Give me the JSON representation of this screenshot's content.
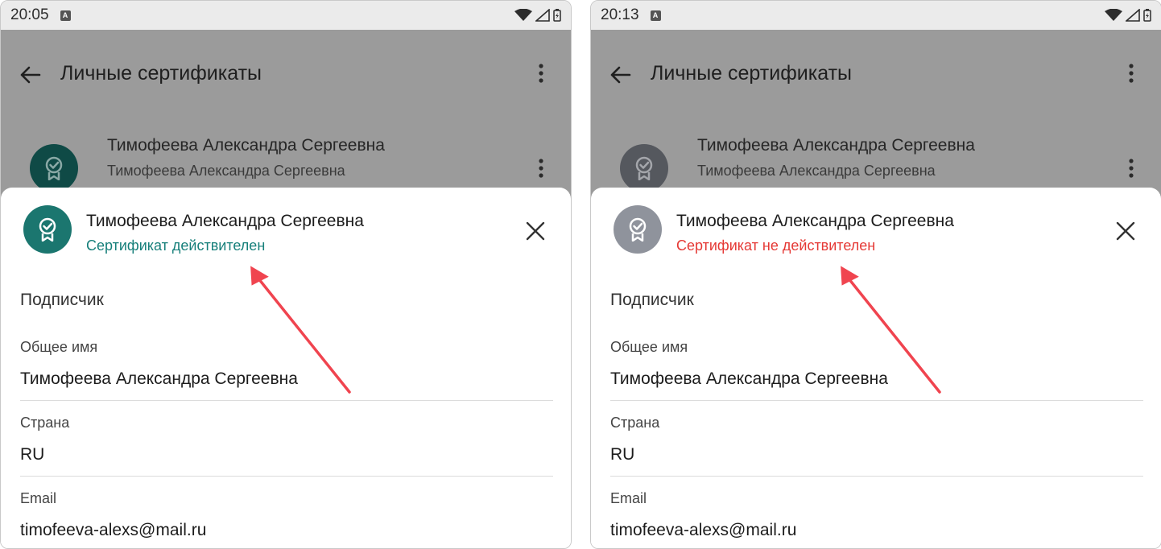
{
  "colors": {
    "valid_avatar": "#1b766f",
    "invalid_avatar": "#8f939c",
    "valid_text": "#167f7a",
    "invalid_text": "#e53935",
    "arrow": "#f0444f",
    "backdrop": "#9b9b9b"
  },
  "left": {
    "status_bar": {
      "time": "20:05",
      "badge": "A"
    },
    "app_title": "Личные сертификаты",
    "list_item": {
      "name": "Тимофеева Александра Сергеевна",
      "subtitle": "Тимофеева Александра Сергеевна"
    },
    "sheet": {
      "name": "Тимофеева Александра Сергеевна",
      "status": "Сертификат действителен",
      "section": "Подписчик",
      "fields": [
        {
          "label": "Общее имя",
          "value": "Тимофеева Александра Сергеевна"
        },
        {
          "label": "Страна",
          "value": "RU"
        },
        {
          "label": "Email",
          "value": "timofeeva-alexs@mail.ru"
        }
      ]
    }
  },
  "right": {
    "status_bar": {
      "time": "20:13",
      "badge": "A"
    },
    "app_title": "Личные сертификаты",
    "list_item": {
      "name": "Тимофеева Александра Сергеевна",
      "subtitle": "Тимофеева Александра Сергеевна"
    },
    "sheet": {
      "name": "Тимофеева Александра Сергеевна",
      "status": "Сертификат не действителен",
      "section": "Подписчик",
      "fields": [
        {
          "label": "Общее имя",
          "value": "Тимофеева Александра Сергеевна"
        },
        {
          "label": "Страна",
          "value": "RU"
        },
        {
          "label": "Email",
          "value": "timofeeva-alexs@mail.ru"
        }
      ]
    }
  },
  "icons": [
    "back-arrow-icon",
    "more-vert-icon",
    "certificate-badge-icon",
    "close-icon",
    "wifi-icon",
    "signal-icon",
    "battery-icon"
  ]
}
